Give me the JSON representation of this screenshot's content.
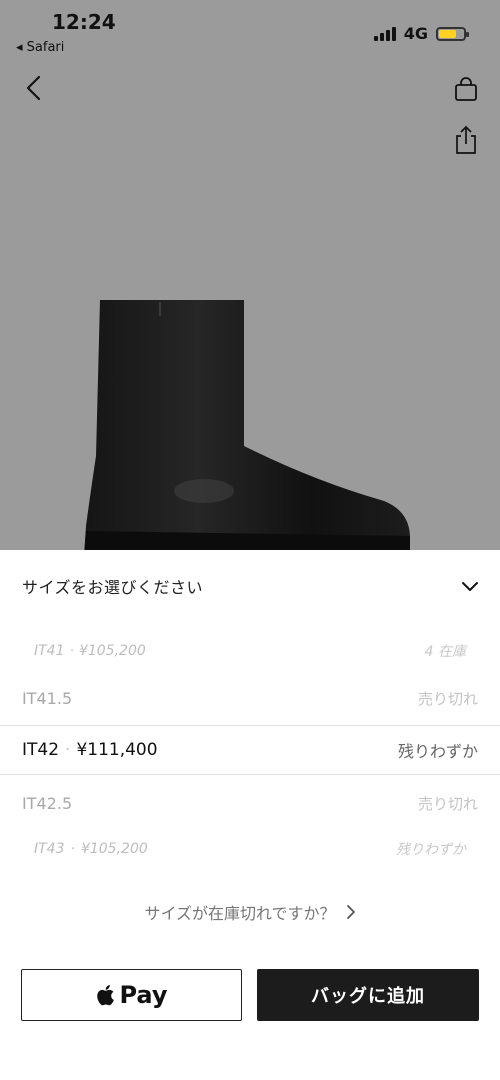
{
  "status_bar": {
    "time": "12:24",
    "back_app": "◂ Safari",
    "network": "4G",
    "battery_level": 0.7,
    "battery_color": "#ffd21f"
  },
  "nav": {
    "back_icon": "chevron-left-icon",
    "bag_icon": "shopping-bag-icon",
    "share_icon": "share-icon"
  },
  "hero": {
    "background": "#9b9b9b",
    "product_image": "black-leather-ankle-boot"
  },
  "size_picker": {
    "title": "サイズをお選びください",
    "toggle_icon": "chevron-down-icon",
    "options": [
      {
        "size": "IT41",
        "sep": "·",
        "price": "¥105,200",
        "stock": "4 在庫"
      },
      {
        "size": "IT41.5",
        "price": "",
        "stock": "売り切れ"
      },
      {
        "size": "IT42",
        "sep": "·",
        "price": "¥111,400",
        "stock": "残りわずか"
      },
      {
        "size": "IT42.5",
        "price": "",
        "stock": "売り切れ"
      },
      {
        "size": "IT43",
        "sep": "·",
        "price": "¥105,200",
        "stock": "残りわずか"
      }
    ],
    "out_of_stock_link": "サイズが在庫切れですか？",
    "out_of_stock_arrow": "›"
  },
  "actions": {
    "apple_pay_label": "Pay",
    "apple_icon": "apple-icon",
    "add_to_bag_label": "バッグに追加"
  }
}
